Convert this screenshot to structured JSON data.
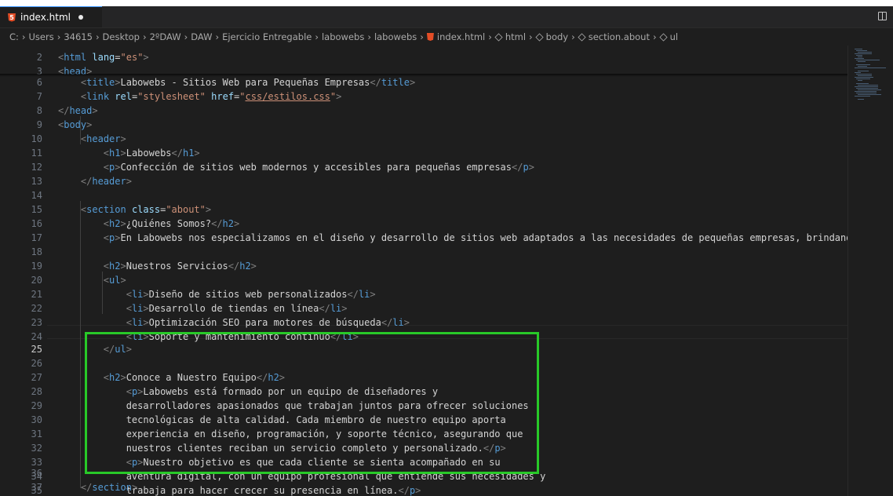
{
  "tab": {
    "filename": "index.html",
    "icon": "html5-icon",
    "html5_glyph": "5"
  },
  "breadcrumb": {
    "items": [
      "C:",
      "Users",
      "34615",
      "Desktop",
      "2ºDAW",
      "DAW",
      "Ejercicio Entregable",
      "labowebs",
      "labowebs",
      "index.html",
      "html",
      "body",
      "section.about",
      "ul"
    ]
  },
  "editor": {
    "line_numbers": [
      "2",
      "3",
      "6",
      "7",
      "8",
      "9",
      "10",
      "11",
      "12",
      "13",
      "14",
      "15",
      "16",
      "17",
      "18",
      "19",
      "20",
      "21",
      "22",
      "23",
      "24",
      "25",
      "26",
      "27",
      "28",
      "29",
      "30",
      "31",
      "32",
      "33",
      "34",
      "35",
      "36",
      "37"
    ],
    "current_line": "25",
    "highlight_color": "#28c928",
    "colors": {
      "tag": "#569cd6",
      "bracket": "#808080",
      "attr": "#9cdcfe",
      "value": "#ce9178",
      "text": "#d4d4d4"
    }
  }
}
